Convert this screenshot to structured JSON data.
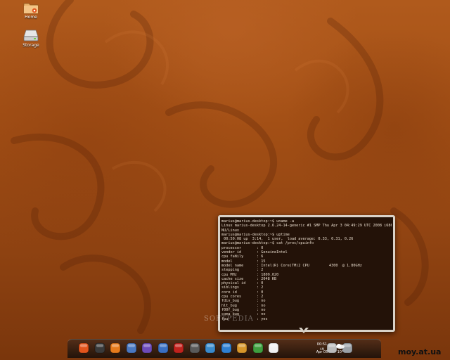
{
  "desktop": {
    "icons": [
      {
        "name": "home",
        "label": "Home"
      },
      {
        "name": "storage",
        "label": "Storage"
      }
    ]
  },
  "terminal": {
    "lines": [
      "marius@marius-desktop:~$ uname -a",
      "Linux marius-desktop 2.6.24-14-generic #1 SMP Thu Apr 3 04:49:29 UTC 2008 i686 G",
      "NU/Linux",
      "marius@marius-desktop:~$ uptime",
      " 00:50:08 up  3:14,  1 user,  load average: 0.33, 0.31, 0.26",
      "marius@marius-desktop:~$ cat /proc/cpuinfo",
      "processor       : 0",
      "vendor_id       : GenuineIntel",
      "cpu family      : 6",
      "model           : 15",
      "model name      : Intel(R) Core(TM)2 CPU         4300  @ 1.80GHz",
      "stepping        : 2",
      "cpu MHz         : 1809.020",
      "cache size      : 2048 KB",
      "physical id     : 0",
      "siblings        : 2",
      "core id         : 0",
      "cpu cores       : 2",
      "fdiv_bug        : no",
      "hlt_bug         : no",
      "f00f_bug        : no",
      "coma_bug        : no",
      "fpu             : yes"
    ]
  },
  "watermark": "SOFTPEDIA",
  "dock": {
    "items": [
      {
        "name": "ubuntu-menu-icon",
        "color": "#e2541c"
      },
      {
        "name": "terminal-icon",
        "color": "#3a3a3a"
      },
      {
        "name": "firefox-icon",
        "color": "#e57a1c"
      },
      {
        "name": "email-client-icon",
        "color": "#4a78c0"
      },
      {
        "name": "messenger-icon",
        "color": "#6d4bb8"
      },
      {
        "name": "network-icon",
        "color": "#3a6fc2"
      },
      {
        "name": "filezilla-icon",
        "color": "#c0221d"
      },
      {
        "name": "tools-icon",
        "color": "#5a5a5a"
      },
      {
        "name": "globe-icon",
        "color": "#3a8acb"
      },
      {
        "name": "music-player-icon",
        "color": "#2f7fd1"
      },
      {
        "name": "media-icon",
        "color": "#d8962a"
      },
      {
        "name": "spreadsheet-icon",
        "color": "#3f9f3f"
      },
      {
        "name": "text-editor-icon",
        "color": "#f1f1f1"
      },
      {
        "name": "drive-icon",
        "color": "#bbbbbb"
      },
      {
        "name": "trash-icon",
        "color": "#9aa0a6"
      }
    ],
    "clock": {
      "time": "00:51",
      "ampm": "AM",
      "date": "Apr 05"
    },
    "weather": {
      "temp": "10°"
    }
  },
  "site_label": "moy.at.ua"
}
